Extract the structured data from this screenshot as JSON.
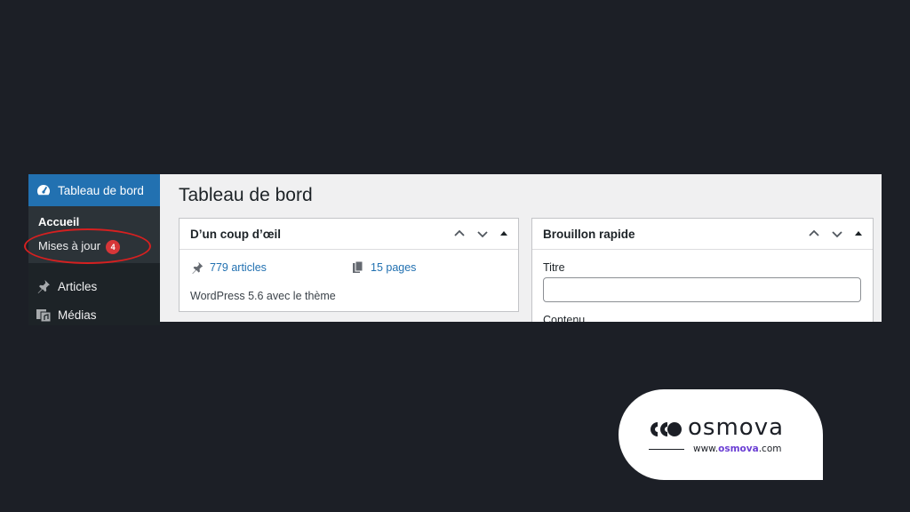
{
  "sidebar": {
    "active_item": "Tableau de bord",
    "submenu": {
      "current": "Accueil",
      "updates_label": "Mises à jour",
      "updates_count": "4"
    },
    "items": [
      {
        "label": "Articles",
        "icon": "pin-icon"
      },
      {
        "label": "Médias",
        "icon": "media-icon"
      }
    ]
  },
  "main": {
    "title": "Tableau de bord",
    "glance": {
      "title": "D’un coup d’œil",
      "articles": "779 articles",
      "pages": "15 pages",
      "version_text": "WordPress 5.6 avec le thème"
    },
    "quick_draft": {
      "title": "Brouillon rapide",
      "title_label": "Titre",
      "content_label": "Contenu",
      "title_value": ""
    }
  },
  "branding": {
    "name": "osmova",
    "url_prefix": "www.",
    "url_brand": "osmova",
    "url_suffix": ".com"
  },
  "colors": {
    "background": "#1c1f26",
    "wp_blue": "#2271b1",
    "badge_red": "#d63638",
    "highlight_oval": "#d62020",
    "brand_purple": "#6b3fd4"
  }
}
